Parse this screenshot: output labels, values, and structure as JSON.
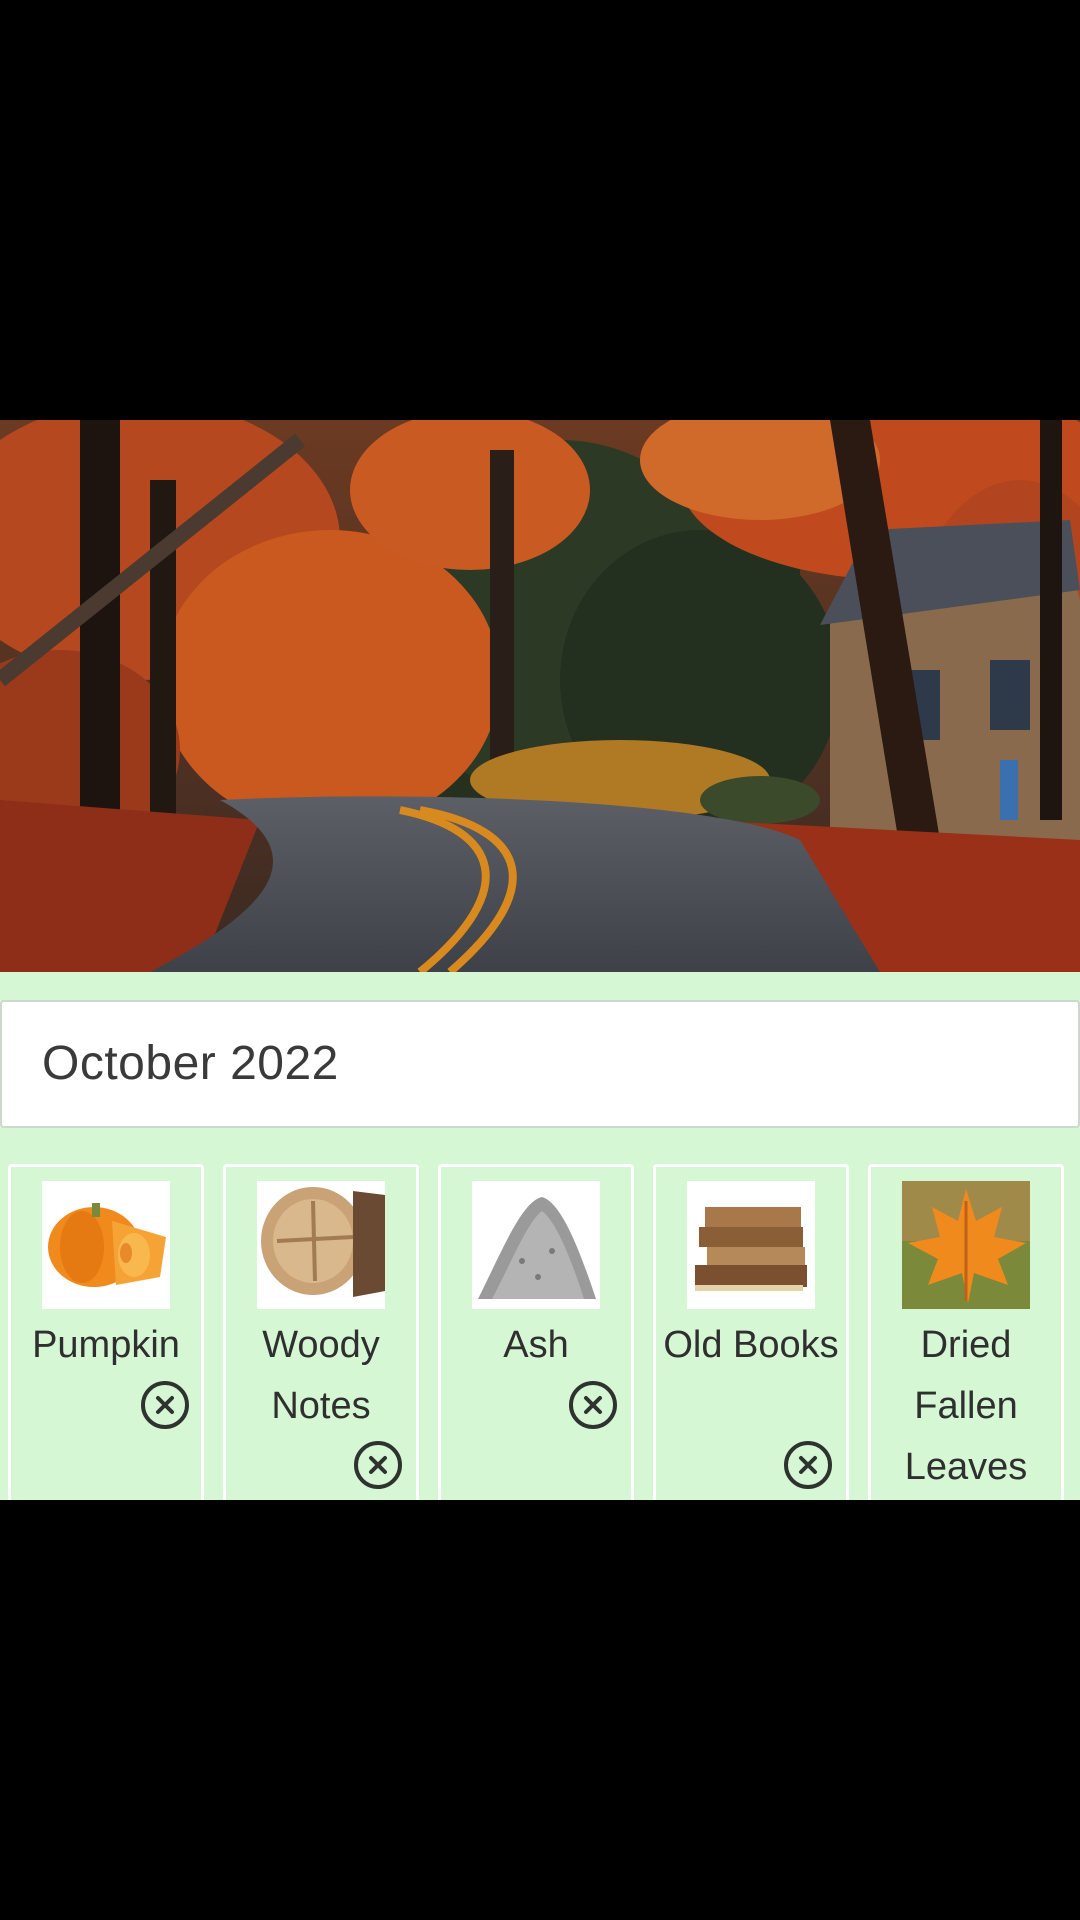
{
  "month_label": "October 2022",
  "hero": {
    "icon": "autumn-road-photo"
  },
  "notes": [
    {
      "label": "Pumpkin",
      "image": "pumpkin-image",
      "removable": true
    },
    {
      "label": "Woody Notes",
      "image": "wood-log-image",
      "removable": true
    },
    {
      "label": "Ash",
      "image": "ash-pile-image",
      "removable": true
    },
    {
      "label": "Old Books",
      "image": "old-books-image",
      "removable": true
    },
    {
      "label": "Dried Fallen Leaves",
      "image": "maple-leaf-image",
      "removable": false
    }
  ],
  "colors": {
    "background": "#000000",
    "panel": "#d6f7d4",
    "card_border": "#ffffff",
    "text": "#2f2f2f"
  }
}
